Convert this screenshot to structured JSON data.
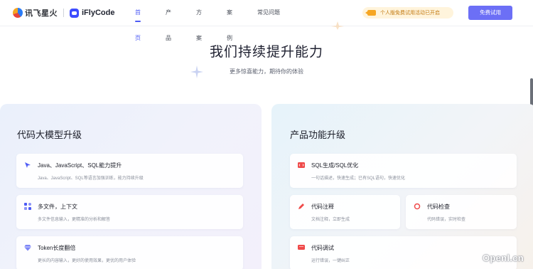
{
  "header": {
    "brand_name": "讯飞星火",
    "product_name": "iFlyCode",
    "nav": [
      "首页",
      "产品",
      "方案",
      "案例",
      "常见问题"
    ],
    "active_nav_index": 0,
    "promo_text": "个人版免费试用活动已开启",
    "trial_button": "免费试用"
  },
  "hero": {
    "title": "我们持续提升能力",
    "subtitle": "更多惊喜能力，期待你的体验"
  },
  "left_panel": {
    "title": "代码大模型升级",
    "cards": [
      {
        "icon": "arrow-icon",
        "title": "Java、JavaScript、SQL能力提升",
        "desc": "Java、JavaScript、SQL等语言加强训练，能力持续升级"
      },
      {
        "icon": "grid-icon",
        "title": "多文件，上下文",
        "desc": "多文件信息输入，更精准的分析和解答"
      },
      {
        "icon": "diamond-icon",
        "title": "Token长度翻倍",
        "desc": "更长的内容输入，更好的使用效果，更优的用户体验"
      }
    ]
  },
  "right_panel": {
    "title": "产品功能升级",
    "cards": [
      {
        "icon": "sql-icon",
        "title": "SQL生成/SQL优化",
        "desc": "一句话描述，快速生成；已有SQL语句，快速优化"
      },
      {
        "icon": "pen-icon",
        "title": "代码注释",
        "desc": "文档注释，立即生成"
      },
      {
        "icon": "inspect-icon",
        "title": "代码检查",
        "desc": "代码错误，实时检查"
      },
      {
        "icon": "debug-icon",
        "title": "代码调试",
        "desc": "运行错误，一键纠正"
      }
    ]
  },
  "watermark": "Openl.cn",
  "colors": {
    "accent": "#4d5bf5",
    "button": "#6c6ff6",
    "promo_bg": "#fff4dc",
    "promo_text": "#c37a12"
  }
}
